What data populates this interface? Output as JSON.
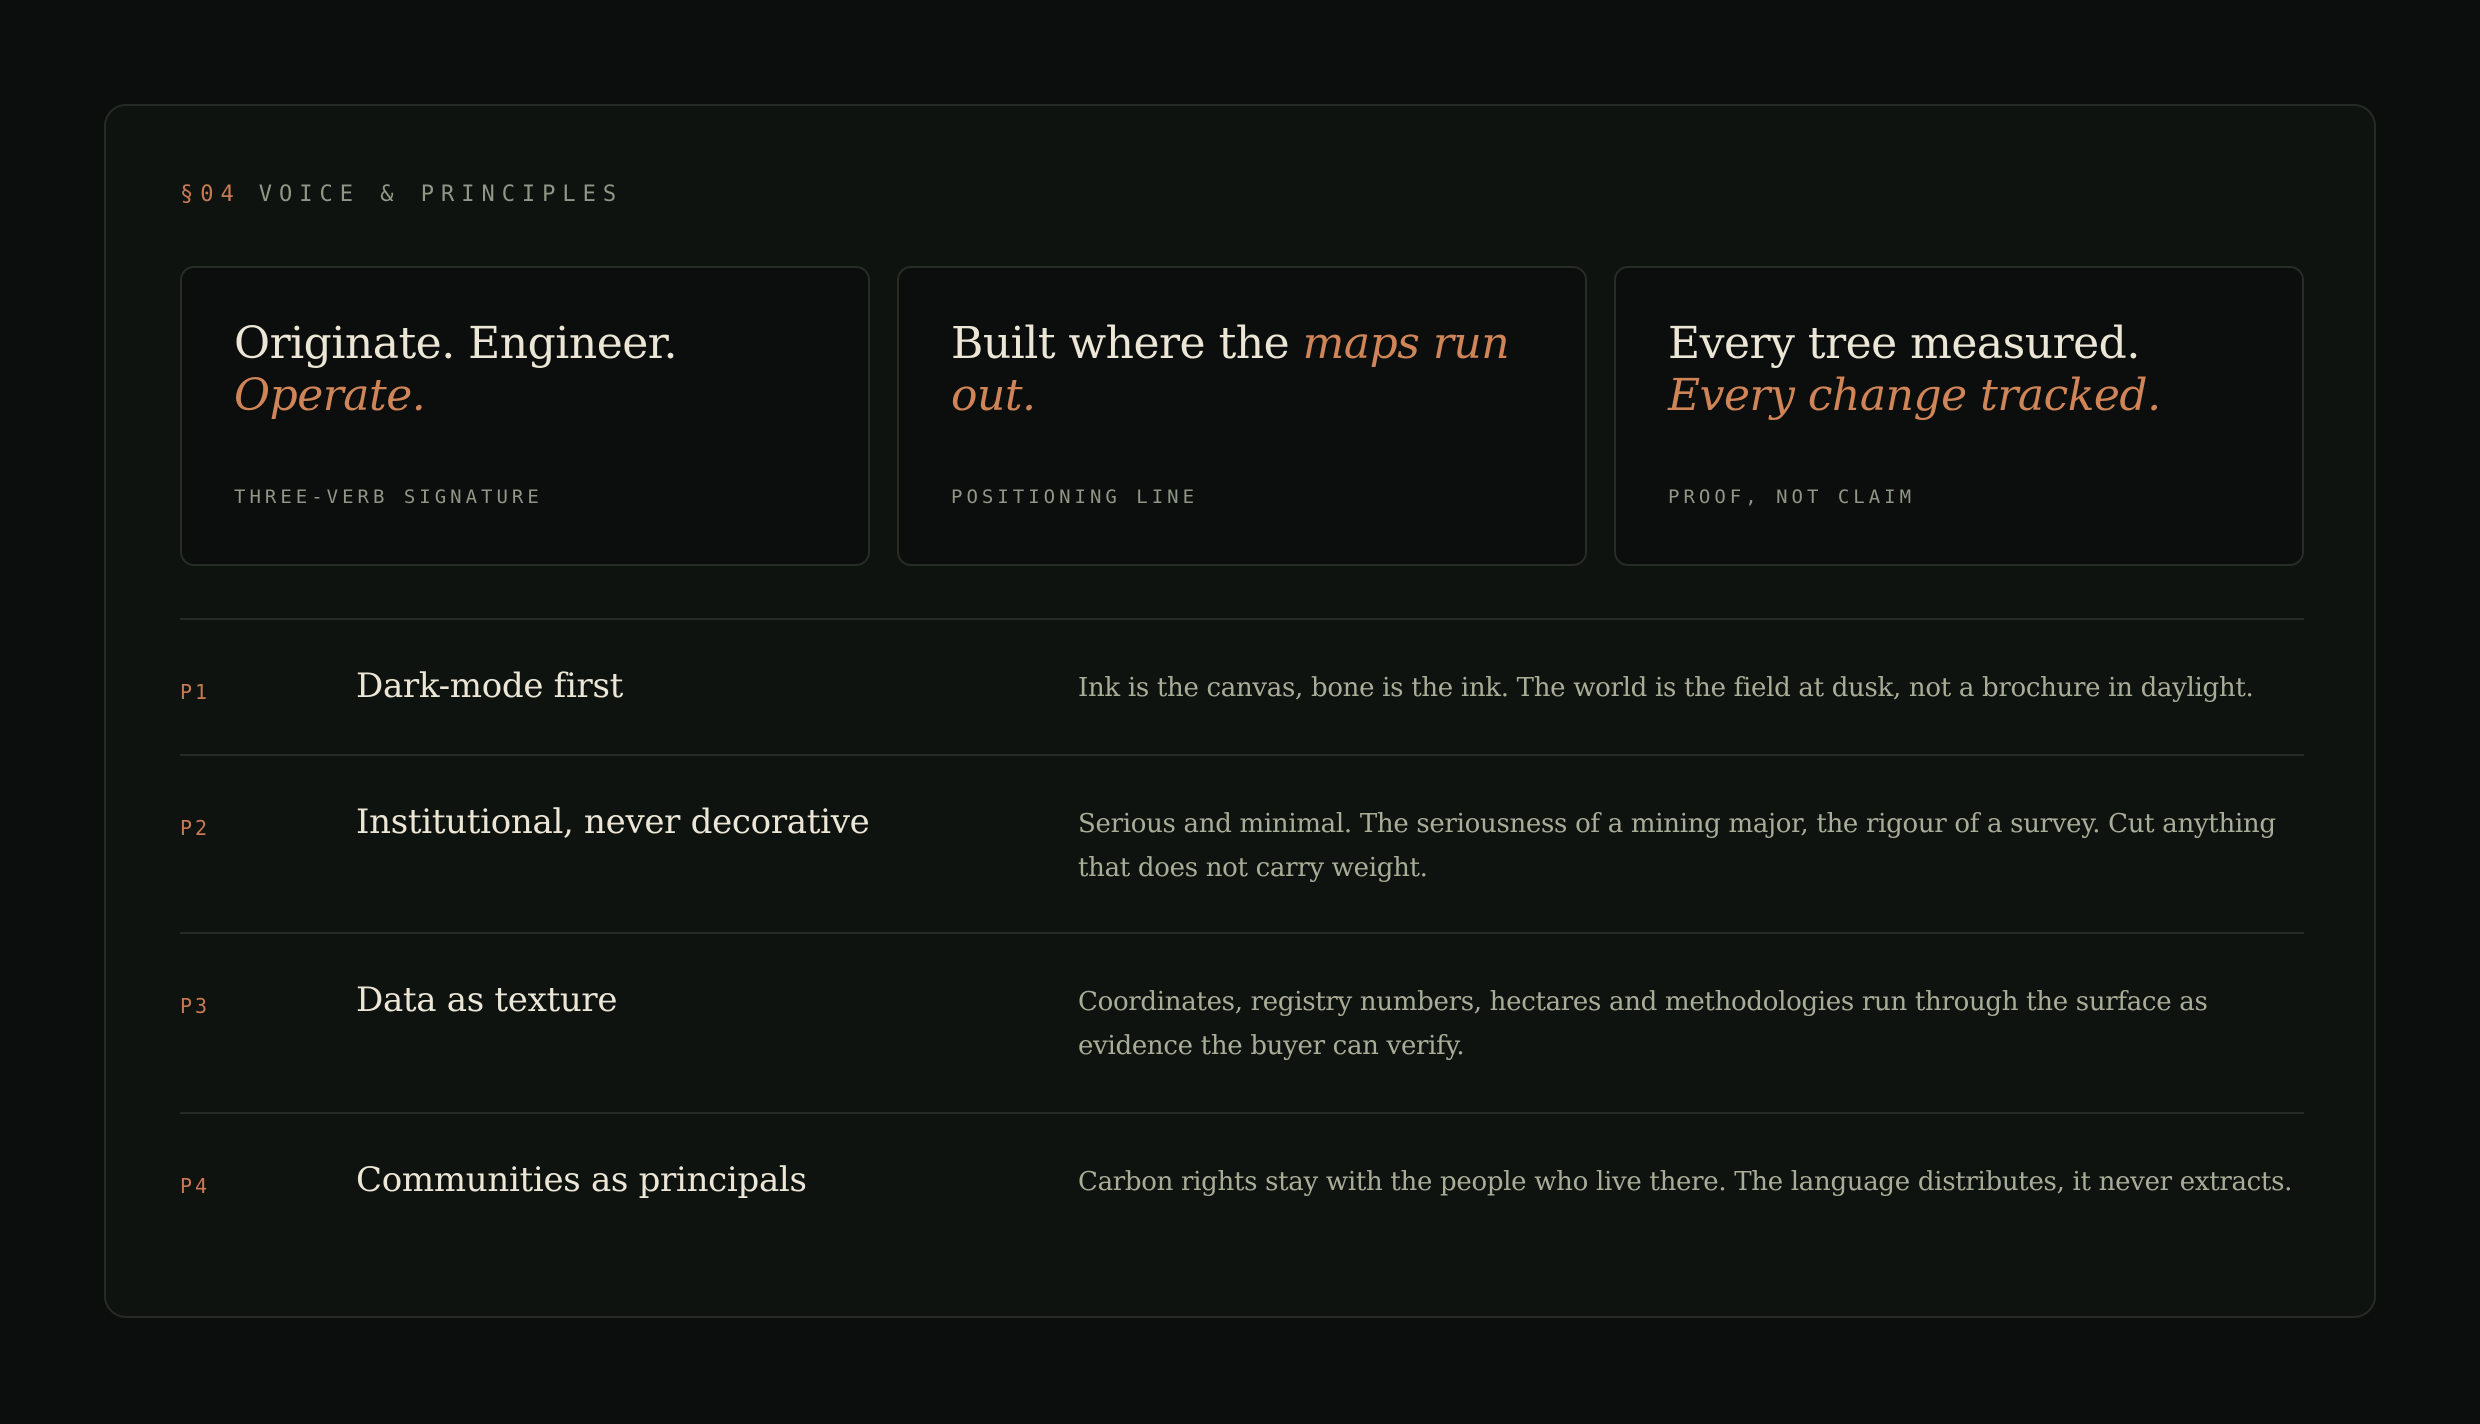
{
  "section": {
    "number": "§04",
    "title": "VOICE & PRINCIPLES"
  },
  "cards": [
    {
      "headline_plain": "Originate. Engineer. ",
      "headline_accent": "Operate.",
      "caption": "THREE-VERB SIGNATURE"
    },
    {
      "headline_plain": "Built where the ",
      "headline_accent": "maps run out.",
      "caption": "POSITIONING LINE"
    },
    {
      "headline_plain": "Every tree measured. ",
      "headline_accent": "Every change tracked.",
      "caption": "PROOF, NOT CLAIM"
    }
  ],
  "principles": [
    {
      "id": "P1",
      "title": "Dark-mode first",
      "description": "Ink is the canvas, bone is the ink. The world is the field at dusk, not a brochure in daylight."
    },
    {
      "id": "P2",
      "title": "Institutional, never decorative",
      "description": "Serious and minimal. The seriousness of a mining major, the rigour of a survey. Cut anything that does not carry weight."
    },
    {
      "id": "P3",
      "title": "Data as texture",
      "description": "Coordinates, registry numbers, hectares and methodologies run through the surface as evidence the buyer can verify."
    },
    {
      "id": "P4",
      "title": "Communities as principals",
      "description": "Carbon rights stay with the people who live there. The language distributes, it never extracts."
    }
  ],
  "colors": {
    "background": "#0b0e0c",
    "panel": "#0f1310",
    "accent": "#d08558",
    "text_primary": "#ece6d6",
    "text_muted": "#a9ad98"
  }
}
